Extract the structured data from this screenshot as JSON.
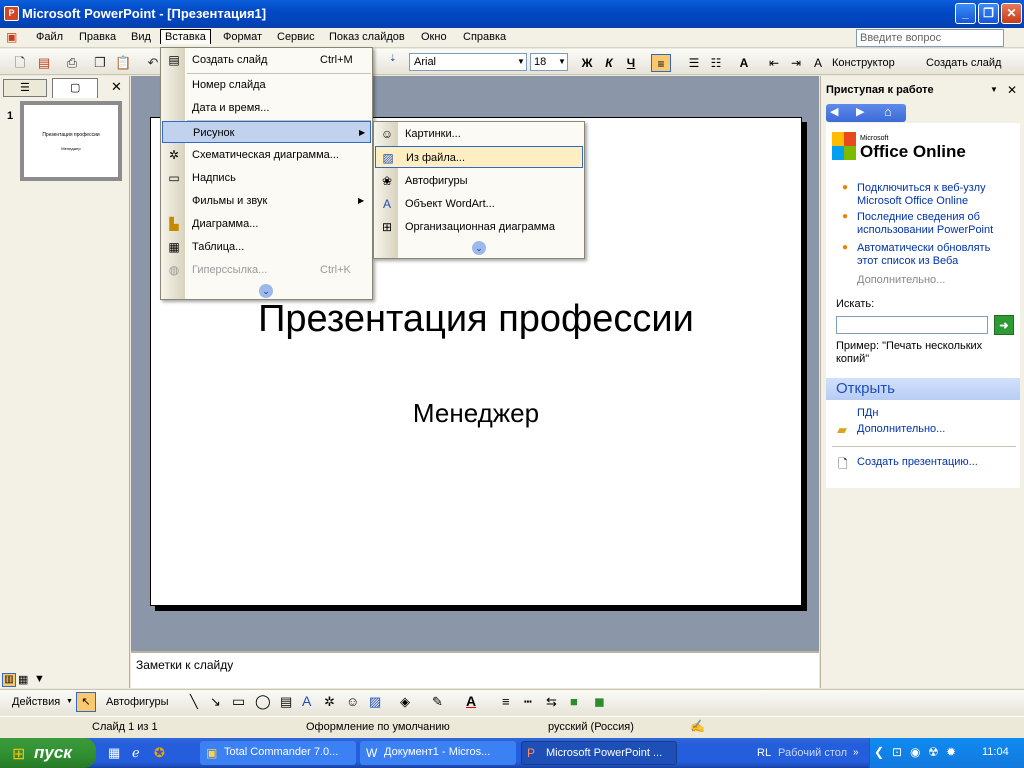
{
  "window": {
    "title": "Microsoft PowerPoint - [Презентация1]",
    "min": "_",
    "restore": "❐",
    "close": "✕"
  },
  "menubar": {
    "items": [
      "Файл",
      "Правка",
      "Вид",
      "Вставка",
      "Формат",
      "Сервис",
      "Показ слайдов",
      "Окно",
      "Справка"
    ],
    "help_placeholder": "Введите вопрос"
  },
  "toolbar": {
    "font": "Arial",
    "size": "18",
    "bold": "Ж",
    "italic": "К",
    "underline": "Ч",
    "designer": "Конструктор",
    "new_slide": "Создать слайд"
  },
  "insert_menu": {
    "items": [
      {
        "label": "Создать слайд",
        "shortcut": "Ctrl+M"
      },
      {
        "label": "Номер слайда"
      },
      {
        "label": "Дата и время..."
      },
      {
        "label": "Рисунок"
      },
      {
        "label": "Схематическая диаграмма..."
      },
      {
        "label": "Надпись"
      },
      {
        "label": "Фильмы и звук"
      },
      {
        "label": "Диаграмма..."
      },
      {
        "label": "Таблица..."
      },
      {
        "label": "Гиперссылка...",
        "shortcut": "Ctrl+K"
      }
    ]
  },
  "picture_menu": {
    "items": [
      {
        "label": "Картинки..."
      },
      {
        "label": "Из файла..."
      },
      {
        "label": "Автофигуры"
      },
      {
        "label": "Объект WordArt..."
      },
      {
        "label": "Организационная диаграмма"
      }
    ]
  },
  "slides_panel": {
    "slide_number": "1",
    "thumb_title": "Презентация профессии",
    "thumb_sub": "Менеджер"
  },
  "slide": {
    "title": "Презентация профессии",
    "subtitle": "Менеджер"
  },
  "notes": {
    "placeholder": "Заметки к слайду"
  },
  "taskpane": {
    "title": "Приступая к работе",
    "office_small": "Microsoft",
    "office_big": "Office Online",
    "links": [
      "Подключиться к веб-узлу Microsoft Office Online",
      "Последние сведения об использовании PowerPoint",
      "Автоматически обновлять этот список из Веба"
    ],
    "more": "Дополнительно...",
    "search_label": "Искать:",
    "example": "Пример: \"Печать нескольких копий\"",
    "open_title": "Открыть",
    "open_items": [
      "ПДн",
      "Дополнительно..."
    ],
    "create": "Создать презентацию..."
  },
  "drawbar": {
    "actions": "Действия",
    "autoshapes": "Автофигуры"
  },
  "statusbar": {
    "slide": "Слайд 1 из 1",
    "design": "Оформление по умолчанию",
    "lang": "русский (Россия)"
  },
  "taskbar": {
    "start": "пуск",
    "tasks": [
      "Total Commander 7.0...",
      "Документ1 - Micros...",
      "Microsoft PowerPoint ..."
    ],
    "lang": "RL",
    "desktop": "Рабочий стол",
    "time": "11:04"
  }
}
